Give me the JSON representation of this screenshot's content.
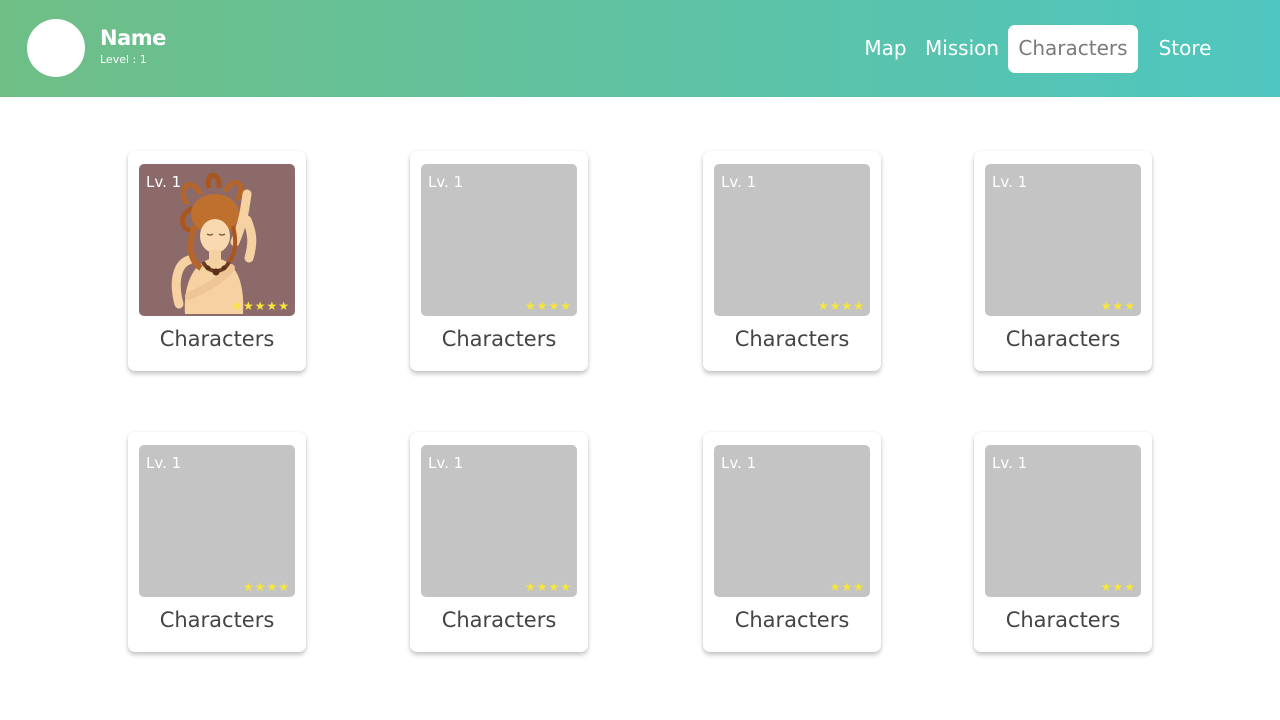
{
  "profile": {
    "name": "Name",
    "level": "Level : 1"
  },
  "nav": {
    "map": "Map",
    "mission": "Mission",
    "characters": "Characters",
    "store": "Store",
    "active": "Characters"
  },
  "colors": {
    "header_start": "#6fbe86",
    "header_end": "#4fc6c0",
    "star": "#f6e63a",
    "thumb_placeholder": "#c4c4c4",
    "portrait_bg": "#8d6a6a"
  },
  "cards": [
    {
      "level": "Lv. 1",
      "stars": "★★★★★",
      "star_count": 5,
      "label": "Characters",
      "image": "character-portrait"
    },
    {
      "level": "Lv. 1",
      "stars": "★★★★",
      "star_count": 4,
      "label": "Characters",
      "image": "placeholder"
    },
    {
      "level": "Lv. 1",
      "stars": "★★★★",
      "star_count": 4,
      "label": "Characters",
      "image": "placeholder"
    },
    {
      "level": "Lv. 1",
      "stars": "★★★",
      "star_count": 3,
      "label": "Characters",
      "image": "placeholder"
    },
    {
      "level": "Lv. 1",
      "stars": "★★★★",
      "star_count": 4,
      "label": "Characters",
      "image": "placeholder"
    },
    {
      "level": "Lv. 1",
      "stars": "★★★★",
      "star_count": 4,
      "label": "Characters",
      "image": "placeholder"
    },
    {
      "level": "Lv. 1",
      "stars": "★★★",
      "star_count": 3,
      "label": "Characters",
      "image": "placeholder"
    },
    {
      "level": "Lv. 1",
      "stars": "★★★",
      "star_count": 3,
      "label": "Characters",
      "image": "placeholder"
    }
  ]
}
